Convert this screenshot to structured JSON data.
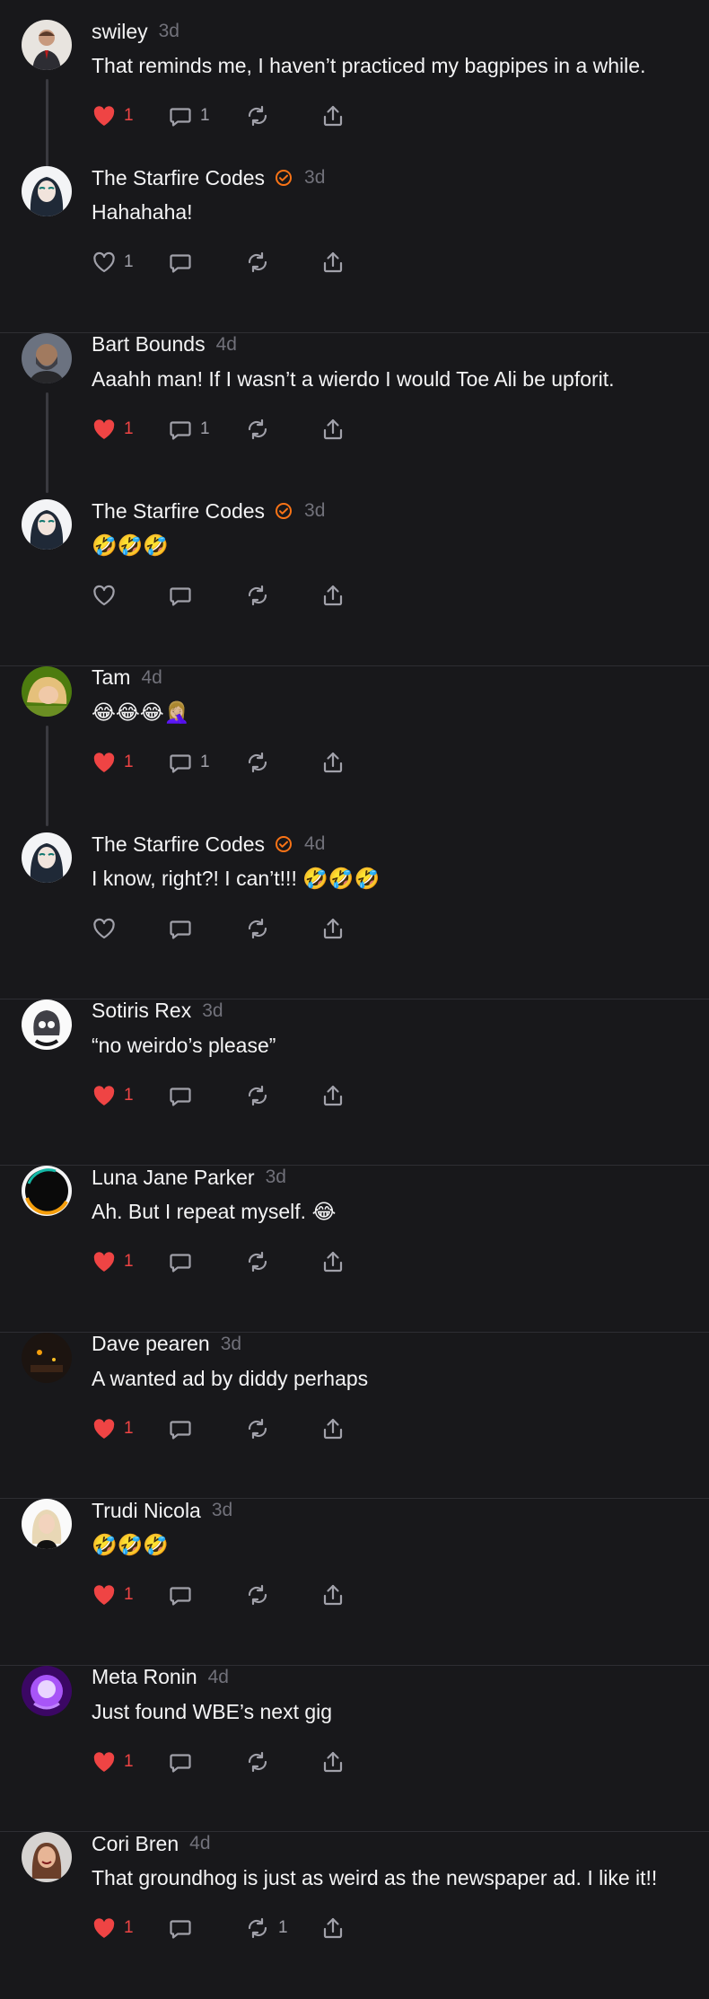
{
  "colors": {
    "background": "#18181b",
    "like": "#ef4444",
    "verified": "#f97316",
    "muted": "#71717a"
  },
  "posts": [
    {
      "name": "swiley",
      "time": "3d",
      "verified": false,
      "text": "That reminds me, I haven’t practiced my bagpipes in a while.",
      "liked": true,
      "likes": "1",
      "replies": "1",
      "reposts": "",
      "thread": true,
      "avatar": "man-in-suit"
    },
    {
      "name": "The Starfire Codes",
      "time": "3d",
      "verified": true,
      "text": "Hahahaha!",
      "liked": false,
      "likes": "1",
      "replies": "",
      "reposts": "",
      "thread": false,
      "avatar": "woman-dark-hair"
    },
    {
      "name": "Bart Bounds",
      "time": "4d",
      "verified": false,
      "text": "Aaahh man! If I wasn’t a wierdo I would Toe Ali be upforit.",
      "liked": true,
      "likes": "1",
      "replies": "1",
      "reposts": "",
      "thread": true,
      "avatar": "bearded-man"
    },
    {
      "name": "The Starfire Codes",
      "time": "3d",
      "verified": true,
      "text": "🤣🤣🤣",
      "liked": false,
      "likes": "",
      "replies": "",
      "reposts": "",
      "thread": false,
      "avatar": "woman-dark-hair"
    },
    {
      "name": "Tam",
      "time": "4d",
      "verified": false,
      "text": "😂😂😂🤦🏼‍♀️",
      "liked": true,
      "likes": "1",
      "replies": "1",
      "reposts": "",
      "thread": true,
      "avatar": "blonde-woman"
    },
    {
      "name": "The Starfire Codes",
      "time": "4d",
      "verified": true,
      "text": "I know, right?! I can’t!!! 🤣🤣🤣",
      "liked": false,
      "likes": "",
      "replies": "",
      "reposts": "",
      "thread": false,
      "avatar": "woman-dark-hair"
    },
    {
      "name": "Sotiris Rex",
      "time": "3d",
      "verified": false,
      "text": "“no weirdo’s please”",
      "liked": true,
      "likes": "1",
      "replies": "",
      "reposts": "",
      "thread": false,
      "avatar": "bw-skull"
    },
    {
      "name": "Luna Jane Parker",
      "time": "3d",
      "verified": false,
      "text": "Ah. But I repeat myself. 😂",
      "liked": true,
      "likes": "1",
      "replies": "",
      "reposts": "",
      "thread": false,
      "avatar": "eclipse-ring"
    },
    {
      "name": "Dave pearen",
      "time": "3d",
      "verified": false,
      "text": "A wanted ad by diddy perhaps",
      "liked": true,
      "likes": "1",
      "replies": "",
      "reposts": "",
      "thread": false,
      "avatar": "dark-room"
    },
    {
      "name": "Trudi Nicola",
      "time": "3d",
      "verified": false,
      "text": "🤣🤣🤣",
      "liked": true,
      "likes": "1",
      "replies": "",
      "reposts": "",
      "thread": false,
      "avatar": "blonde-portrait"
    },
    {
      "name": "Meta Ronin",
      "time": "4d",
      "verified": false,
      "text": "Just found WBE’s next gig",
      "liked": true,
      "likes": "1",
      "replies": "",
      "reposts": "",
      "thread": false,
      "avatar": "purple-glow"
    },
    {
      "name": "Cori Bren",
      "time": "4d",
      "verified": false,
      "text": "That groundhog is just as weird as the newspaper ad. I like it!!",
      "liked": true,
      "likes": "1",
      "replies": "",
      "reposts": "1",
      "thread": false,
      "avatar": "woman-smiling"
    }
  ]
}
